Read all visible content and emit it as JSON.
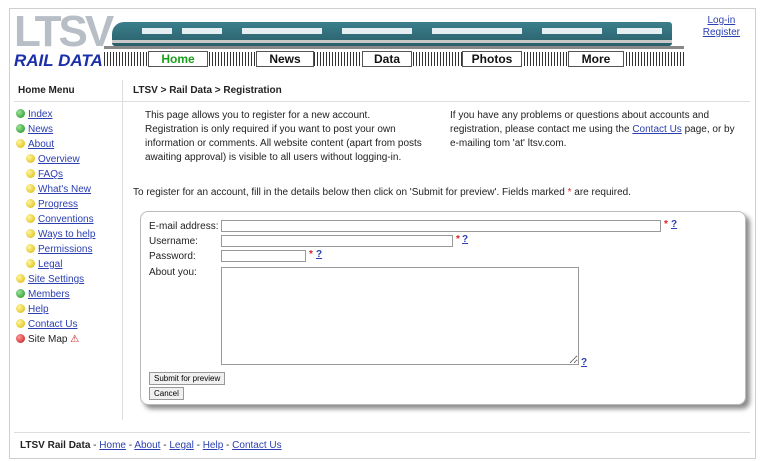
{
  "logo": {
    "letters": "LTSV",
    "subtitle": "RAIL DATA"
  },
  "nav": [
    {
      "label": "Home",
      "active": true
    },
    {
      "label": "News",
      "active": false
    },
    {
      "label": "Data",
      "active": false
    },
    {
      "label": "Photos",
      "active": false
    },
    {
      "label": "More",
      "active": false
    }
  ],
  "auth": {
    "login": "Log-in",
    "register": "Register"
  },
  "sidebar": {
    "title": "Home Menu",
    "items": [
      {
        "label": "Index",
        "dot": "green",
        "sub": false,
        "link": true
      },
      {
        "label": "News",
        "dot": "green",
        "sub": false,
        "link": true
      },
      {
        "label": "About",
        "dot": "yellow",
        "sub": false,
        "link": true
      },
      {
        "label": "Overview",
        "dot": "yellow",
        "sub": true,
        "link": true
      },
      {
        "label": "FAQs",
        "dot": "yellow",
        "sub": true,
        "link": true
      },
      {
        "label": "What's New",
        "dot": "yellow",
        "sub": true,
        "link": true
      },
      {
        "label": "Progress",
        "dot": "yellow",
        "sub": true,
        "link": true
      },
      {
        "label": "Conventions",
        "dot": "yellow",
        "sub": true,
        "link": true
      },
      {
        "label": "Ways to help",
        "dot": "yellow",
        "sub": true,
        "link": true
      },
      {
        "label": "Permissions",
        "dot": "yellow",
        "sub": true,
        "link": true
      },
      {
        "label": "Legal",
        "dot": "yellow",
        "sub": true,
        "link": true
      },
      {
        "label": "Site Settings",
        "dot": "yellow",
        "sub": false,
        "link": true
      },
      {
        "label": "Members",
        "dot": "green",
        "sub": false,
        "link": true
      },
      {
        "label": "Help",
        "dot": "yellow",
        "sub": false,
        "link": true
      },
      {
        "label": "Contact Us",
        "dot": "yellow",
        "sub": false,
        "link": true
      },
      {
        "label": "Site Map",
        "dot": "red",
        "sub": false,
        "link": false,
        "warning": "⚠"
      }
    ]
  },
  "main": {
    "breadcrumb": "LTSV > Rail Data > Registration",
    "intro_1": "This page allows you to register for a new account.",
    "intro_2": "Registration is only required if you want to post your own information or comments. All website content (apart from posts awaiting approval) is visible to all users without logging-in.",
    "contact_before": "If you have any problems or questions about accounts and registration, please contact me using the",
    "contact_link": "Contact Us",
    "contact_after": "page, or by e-mailing tom 'at' ltsv.com.",
    "instruction_before": "To register for an account, fill in the details below then click on 'Submit for preview'. Fields marked",
    "instruction_star": "*",
    "instruction_after": "are required."
  },
  "form": {
    "email_label": "E-mail address:",
    "email_value": "",
    "username_label": "Username:",
    "username_value": "",
    "password_label": "Password:",
    "password_value": "",
    "about_label": "About you:",
    "about_value": "",
    "required_mark": "*",
    "help_mark": "?",
    "submit_label": "Submit for preview",
    "cancel_label": "Cancel"
  },
  "footer": {
    "site": "LTSV Rail Data",
    "sep": " - ",
    "links": [
      "Home",
      "About",
      "Legal",
      "Help",
      "Contact Us"
    ]
  },
  "colors": {
    "link": "#2b3fb0",
    "active_tab": "#1a9f1a",
    "logo_blue": "#1b2fa8",
    "required": "#dd2222"
  }
}
